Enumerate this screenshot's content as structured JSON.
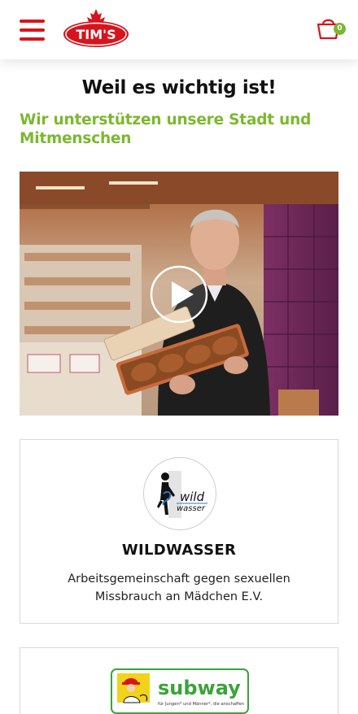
{
  "header": {
    "brand_logo_text": "TIM'S",
    "cart_count": "0",
    "icons": {
      "menu": "hamburger-menu-icon",
      "cart": "shopping-basket-icon"
    },
    "colors": {
      "brand_red": "#d7141d",
      "accent_green": "#7cb82f"
    }
  },
  "main": {
    "title": "Weil es wichtig ist!",
    "subtitle": "Wir unterstützen unsere Stadt und Mitmenschen",
    "video": {
      "play_icon": "play-icon"
    }
  },
  "organizations": [
    {
      "logo_text_1": "wild",
      "logo_text_2": "wasser",
      "name": "WILDWASSER",
      "description": "Arbeitsgemeinschaft gegen sexuellen Missbrauch an Mädchen E.V."
    },
    {
      "logo_text": "subway",
      "logo_tagline": "für Jungen* und Männer*, die anschaffen"
    }
  ]
}
